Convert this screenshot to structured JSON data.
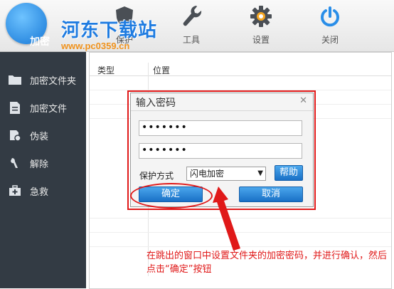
{
  "toolbar": {
    "items": [
      {
        "label": "加密",
        "icon": "lock-icon"
      },
      {
        "label": "保护",
        "icon": "shield-icon"
      },
      {
        "label": "工具",
        "icon": "wrench-icon"
      },
      {
        "label": "设置",
        "icon": "gear-icon"
      },
      {
        "label": "关闭",
        "icon": "power-icon"
      }
    ]
  },
  "watermark": {
    "site_name": "河东下载站",
    "url": "www.pc0359.cn"
  },
  "sidebar": {
    "items": [
      {
        "label": "加密文件夹",
        "icon": "folder-icon"
      },
      {
        "label": "加密文件",
        "icon": "file-icon"
      },
      {
        "label": "伪装",
        "icon": "disguise-icon"
      },
      {
        "label": "解除",
        "icon": "unlock-icon"
      },
      {
        "label": "急救",
        "icon": "first-aid-icon"
      }
    ]
  },
  "table": {
    "columns": [
      "类型",
      "位置"
    ]
  },
  "dialog": {
    "title": "输入密码",
    "password": "•••••••",
    "confirm_password": "•••••••",
    "mode_label": "保护方式",
    "mode_value": "闪电加密",
    "help_label": "帮助",
    "ok_label": "确定",
    "cancel_label": "取消"
  },
  "annotation": "在跳出的窗口中设置文件夹的加密密码，并进行确认，然后点击“确定”按钮",
  "colors": {
    "accent": "#1e78d0",
    "highlight": "#e01919",
    "sidebar_bg": "#333b44"
  }
}
